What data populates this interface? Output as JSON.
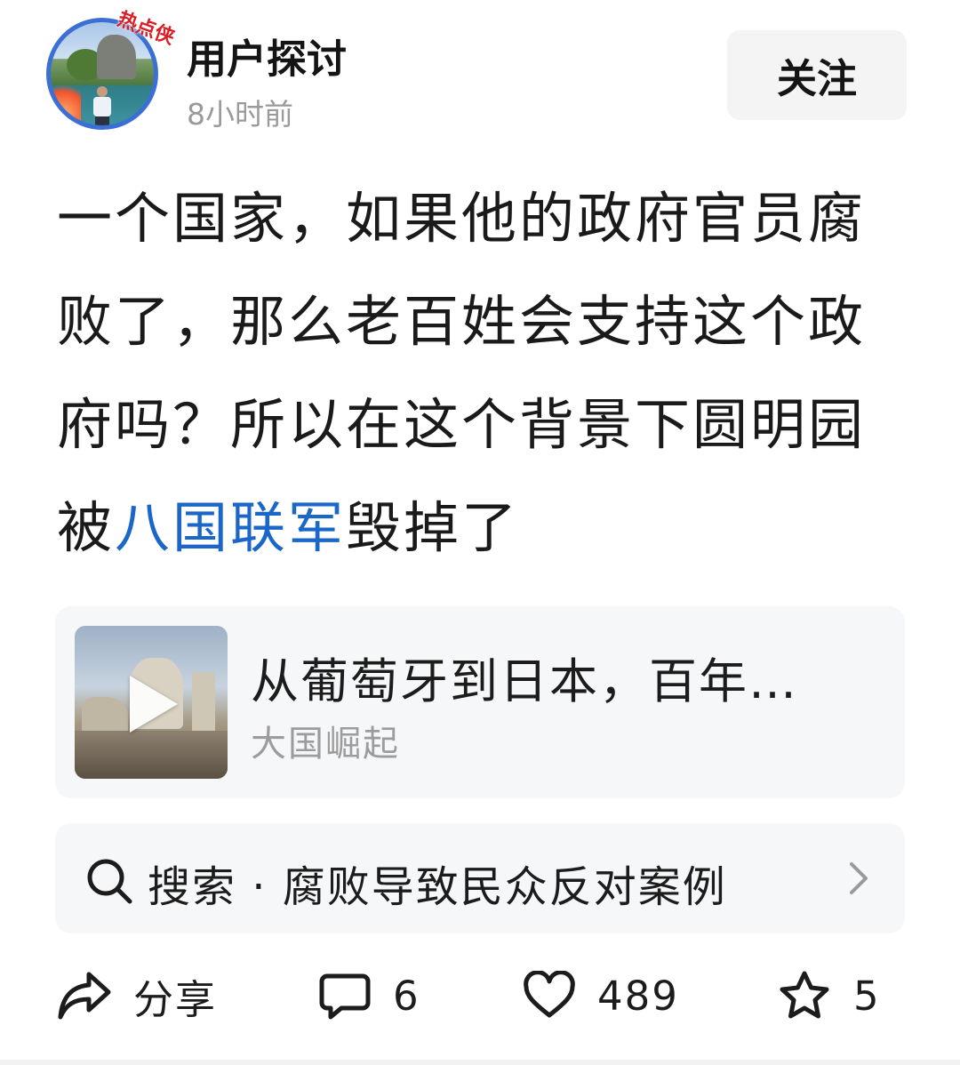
{
  "header": {
    "author_name": "用户探讨",
    "timestamp": "8小时前",
    "follow_label": "关注",
    "avatar_badge_text": "热点侠"
  },
  "post": {
    "text_before_link": "一个国家，如果他的政府官员腐败了，那么老百姓会支持这个政府吗？所以在这个背景下圆明园被",
    "link_text": "八国联军",
    "text_after_link": "毁掉了"
  },
  "video_card": {
    "title": "从葡萄牙到日本，百年…",
    "source": "大国崛起",
    "play_icon": "play-icon"
  },
  "search_suggestion": {
    "text": "搜索 · 腐败导致民众反对案例",
    "icon": "search-icon"
  },
  "actions": {
    "share_label": "分享",
    "comment_count": "6",
    "like_count": "489",
    "favorite_count": "5"
  },
  "colors": {
    "link": "#1a66c9",
    "secondary_text": "#9a9a9a",
    "card_bg": "#f6f7f9",
    "avatar_ring": "#3b6fd6",
    "badge_red": "#d81f26"
  }
}
